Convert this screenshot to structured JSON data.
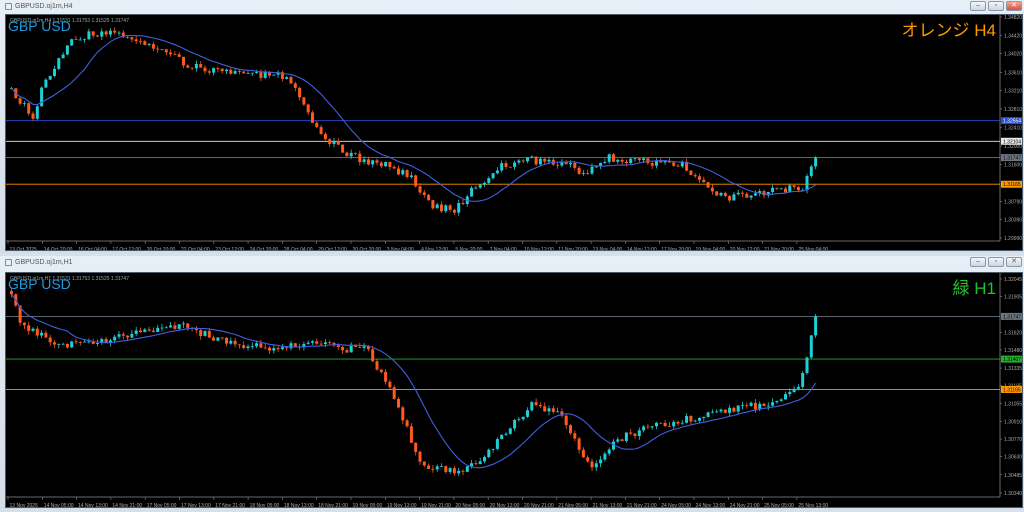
{
  "colors": {
    "bull": "#1ecfd6",
    "bear": "#ff5a1e",
    "ma": "#3f5fe0",
    "bg": "#000000",
    "axis": "#8a8a8a"
  },
  "windows": [
    {
      "title": "GBPUSD.oj1m,H4",
      "symbol_label": "GBP USD",
      "ohlc": "GBPUSD.oj1m,H4  1.31531 1.31753 1.31525 1.31747",
      "corner_label": "オレンジ H4",
      "corner_color": "#ff9a00",
      "buttons": {
        "minimize": "–",
        "restore": "▫",
        "close": "✕"
      },
      "price_range": [
        1.2999,
        1.3482
      ],
      "price_ticks": [
        "1.34820",
        "1.34420",
        "1.34020",
        "1.33610",
        "1.33210",
        "1.32810",
        "1.32410",
        "1.32000",
        "1.31600",
        "1.30790",
        "1.30390",
        "1.29990"
      ],
      "levels": [
        {
          "price": 1.32554,
          "label": "1.32554",
          "color": "#2a4fd8",
          "text": "#ffffff"
        },
        {
          "price": 1.32104,
          "label": "1.32104",
          "color": "#e8e8e8",
          "text": "#000000"
        },
        {
          "price": 1.31747,
          "label": "1.31747",
          "color": "#6c7680",
          "text": "#000000"
        },
        {
          "price": 1.31165,
          "label": "1.31165",
          "color": "#ff9a00",
          "text": "#000000"
        }
      ],
      "time_labels": [
        "13 Oct 2025",
        "14 Oct 20:00",
        "16 Oct 04:00",
        "17 Oct 12:00",
        "20 Oct 20:00",
        "22 Oct 04:00",
        "23 Oct 12:00",
        "24 Oct 20:00",
        "28 Oct 04:00",
        "29 Oct 12:00",
        "30 Oct 20:00",
        "3 Nov 04:00",
        "4 Nov 12:00",
        "5 Nov 20:00",
        "7 Nov 04:00",
        "10 Nov 12:00",
        "11 Nov 20:00",
        "13 Nov 04:00",
        "14 Nov 12:00",
        "17 Nov 20:00",
        "19 Nov 04:00",
        "20 Nov 12:00",
        "21 Nov 20:00",
        "25 Nov 04:00"
      ],
      "candles": 188,
      "noise": 0.0011,
      "path": [
        [
          0,
          1.3325
        ],
        [
          5,
          1.3262
        ],
        [
          7,
          1.3325
        ],
        [
          14,
          1.3435
        ],
        [
          21,
          1.3447
        ],
        [
          28,
          1.344
        ],
        [
          35,
          1.341
        ],
        [
          42,
          1.3372
        ],
        [
          54,
          1.3357
        ],
        [
          64,
          1.3352
        ],
        [
          68,
          1.3285
        ],
        [
          73,
          1.322
        ],
        [
          78,
          1.318
        ],
        [
          87,
          1.3158
        ],
        [
          93,
          1.313
        ],
        [
          98,
          1.307
        ],
        [
          103,
          1.306
        ],
        [
          107,
          1.31
        ],
        [
          114,
          1.3158
        ],
        [
          119,
          1.317
        ],
        [
          128,
          1.3165
        ],
        [
          133,
          1.314
        ],
        [
          139,
          1.3175
        ],
        [
          147,
          1.3165
        ],
        [
          156,
          1.316
        ],
        [
          161,
          1.312
        ],
        [
          166,
          1.3085
        ],
        [
          175,
          1.3098
        ],
        [
          184,
          1.311
        ],
        [
          187,
          1.31747
        ]
      ]
    },
    {
      "title": "GBPUSD.oj1m,H1",
      "symbol_label": "GBP USD",
      "ohlc": "GBPUSD.oj1m,H1  1.31531 1.31753 1.31525 1.31747",
      "corner_label": "緑 H1",
      "corner_color": "#22c22a",
      "buttons": {
        "minimize": "–",
        "restore": "▫",
        "close": "✕"
      },
      "price_range": [
        1.3034,
        1.32045
      ],
      "price_ticks": [
        "1.32045",
        "1.31905",
        "1.31620",
        "1.31480",
        "1.31335",
        "1.31195",
        "1.31055",
        "1.30910",
        "1.30770",
        "1.30630",
        "1.30485",
        "1.30340"
      ],
      "levels": [
        {
          "price": 1.31747,
          "label": "1.31747",
          "color": "#6c7680",
          "text": "#000000"
        },
        {
          "price": 1.31407,
          "label": "1.31407",
          "color": "#22b02a",
          "text": "#000000"
        },
        {
          "price": 1.31165,
          "label": "1.31165",
          "color": "#ff9a00",
          "text": "#000000"
        }
      ],
      "time_labels": [
        "13 Nov 2025",
        "14 Nov 05:00",
        "14 Nov 13:00",
        "14 Nov 21:00",
        "17 Nov 05:00",
        "17 Nov 13:00",
        "17 Nov 21:00",
        "18 Nov 05:00",
        "18 Nov 13:00",
        "18 Nov 21:00",
        "19 Nov 05:00",
        "19 Nov 13:00",
        "19 Nov 21:00",
        "20 Nov 05:00",
        "20 Nov 13:00",
        "20 Nov 21:00",
        "21 Nov 05:00",
        "21 Nov 13:00",
        "21 Nov 21:00",
        "24 Nov 05:00",
        "24 Nov 13:00",
        "24 Nov 21:00",
        "25 Nov 05:00",
        "25 Nov 13:00"
      ],
      "candles": 188,
      "noise": 0.00045,
      "path": [
        [
          0,
          1.3195
        ],
        [
          2,
          1.3168
        ],
        [
          12,
          1.3152
        ],
        [
          21,
          1.3156
        ],
        [
          40,
          1.3166
        ],
        [
          54,
          1.315
        ],
        [
          68,
          1.3152
        ],
        [
          83,
          1.3148
        ],
        [
          88,
          1.3115
        ],
        [
          96,
          1.3055
        ],
        [
          105,
          1.305
        ],
        [
          113,
          1.3075
        ],
        [
          121,
          1.3105
        ],
        [
          128,
          1.3095
        ],
        [
          135,
          1.3052
        ],
        [
          140,
          1.3075
        ],
        [
          152,
          1.309
        ],
        [
          161,
          1.3095
        ],
        [
          175,
          1.3105
        ],
        [
          183,
          1.3115
        ],
        [
          187,
          1.31747
        ]
      ]
    }
  ]
}
